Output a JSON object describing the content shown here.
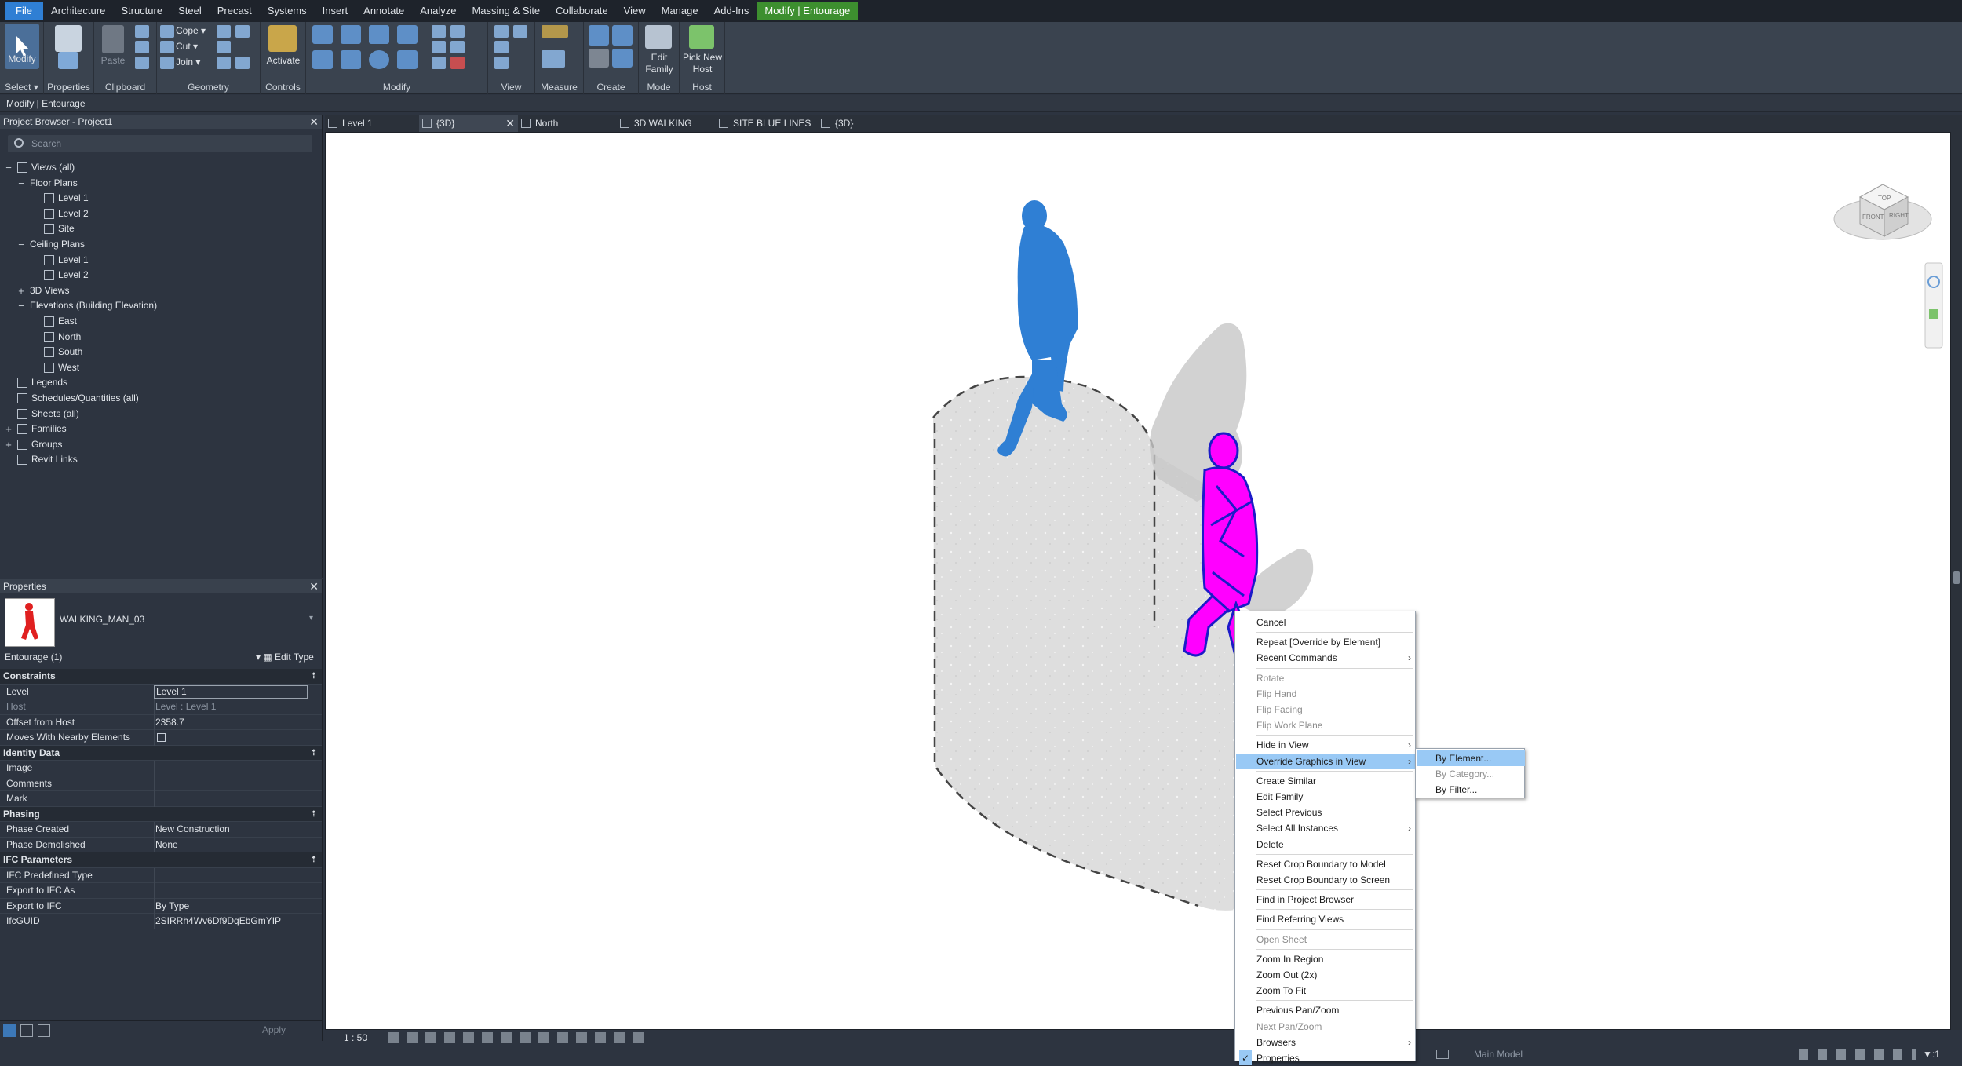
{
  "menubar": {
    "items": [
      "File",
      "Architecture",
      "Structure",
      "Steel",
      "Precast",
      "Systems",
      "Insert",
      "Annotate",
      "Analyze",
      "Massing & Site",
      "Collaborate",
      "View",
      "Manage",
      "Add-Ins",
      "Modify | Entourage"
    ]
  },
  "ribbon": {
    "modify_label": "Modify",
    "properties_label": "Properties",
    "paste_label": "Paste",
    "cope_label": "Cope",
    "cut_label": "Cut",
    "join_label": "Join",
    "activate_label": "Activate",
    "edit_family_label": "Edit Family",
    "pick_new_host_label": "Pick New Host",
    "panels": {
      "select": "Select",
      "properties": "Properties",
      "clipboard": "Clipboard",
      "geometry": "Geometry",
      "controls": "Controls",
      "modify": "Modify",
      "view": "View",
      "measure": "Measure",
      "create": "Create",
      "mode": "Mode",
      "host": "Host"
    }
  },
  "context_bar": "Modify | Entourage",
  "project_browser": {
    "title": "Project Browser - Project1",
    "search_placeholder": "Search",
    "tree": [
      {
        "label": "Views (all)",
        "level": 0,
        "toggle": "−"
      },
      {
        "label": "Floor Plans",
        "level": 1,
        "toggle": "−"
      },
      {
        "label": "Level 1",
        "level": 2,
        "toggle": ""
      },
      {
        "label": "Level 2",
        "level": 2,
        "toggle": ""
      },
      {
        "label": "Site",
        "level": 2,
        "toggle": ""
      },
      {
        "label": "Ceiling Plans",
        "level": 1,
        "toggle": "−"
      },
      {
        "label": "Level 1",
        "level": 2,
        "toggle": ""
      },
      {
        "label": "Level 2",
        "level": 2,
        "toggle": ""
      },
      {
        "label": "3D Views",
        "level": 1,
        "toggle": "+"
      },
      {
        "label": "Elevations (Building Elevation)",
        "level": 1,
        "toggle": "−"
      },
      {
        "label": "East",
        "level": 2,
        "toggle": ""
      },
      {
        "label": "North",
        "level": 2,
        "toggle": ""
      },
      {
        "label": "South",
        "level": 2,
        "toggle": ""
      },
      {
        "label": "West",
        "level": 2,
        "toggle": ""
      },
      {
        "label": "Legends",
        "level": 0,
        "toggle": ""
      },
      {
        "label": "Schedules/Quantities (all)",
        "level": 0,
        "toggle": ""
      },
      {
        "label": "Sheets (all)",
        "level": 0,
        "toggle": ""
      },
      {
        "label": "Families",
        "level": 0,
        "toggle": "+"
      },
      {
        "label": "Groups",
        "level": 0,
        "toggle": "+"
      },
      {
        "label": "Revit Links",
        "level": 0,
        "toggle": ""
      }
    ]
  },
  "properties": {
    "title": "Properties",
    "type_name": "WALKING_MAN_03",
    "instance_filter": "Entourage (1)",
    "edit_type": "Edit Type",
    "apply": "Apply",
    "rows": [
      {
        "k": "Constraints",
        "v": "",
        "kind": "sect"
      },
      {
        "k": "Level",
        "v": "Level 1",
        "kind": "edit"
      },
      {
        "k": "Host",
        "v": "Level : Level 1",
        "kind": "grey"
      },
      {
        "k": "Offset from Host",
        "v": "2358.7",
        "kind": ""
      },
      {
        "k": "Moves With Nearby Elements",
        "v": "",
        "kind": "check"
      },
      {
        "k": "Identity Data",
        "v": "",
        "kind": "sect"
      },
      {
        "k": "Image",
        "v": "",
        "kind": ""
      },
      {
        "k": "Comments",
        "v": "",
        "kind": ""
      },
      {
        "k": "Mark",
        "v": "",
        "kind": ""
      },
      {
        "k": "Phasing",
        "v": "",
        "kind": "sect"
      },
      {
        "k": "Phase Created",
        "v": "New Construction",
        "kind": ""
      },
      {
        "k": "Phase Demolished",
        "v": "None",
        "kind": ""
      },
      {
        "k": "IFC Parameters",
        "v": "",
        "kind": "sect"
      },
      {
        "k": "IFC Predefined Type",
        "v": "",
        "kind": ""
      },
      {
        "k": "Export to IFC As",
        "v": "",
        "kind": ""
      },
      {
        "k": "Export to IFC",
        "v": "By Type",
        "kind": ""
      },
      {
        "k": "IfcGUID",
        "v": "2SIRRh4Wv6Df9DqEbGmYIP",
        "kind": ""
      }
    ]
  },
  "tabs": [
    {
      "label": "Level 1",
      "active": false
    },
    {
      "label": "{3D}",
      "active": true
    },
    {
      "label": "North",
      "active": false
    },
    {
      "label": "3D WALKING",
      "active": false
    },
    {
      "label": "SITE BLUE LINES",
      "active": false
    },
    {
      "label": "{3D}",
      "active": false
    }
  ],
  "viewbar": {
    "scale": "1 : 50"
  },
  "statusbar": {
    "model": "Main Model",
    "filter_count": ":1"
  },
  "viewcube": {
    "top": "TOP",
    "front": "FRONT",
    "right": "RIGHT"
  },
  "context_menu": {
    "items": [
      {
        "label": "Cancel",
        "state": "",
        "sub": false
      },
      {
        "sep": true
      },
      {
        "label": "Repeat [Override by Element]",
        "state": "",
        "sub": false
      },
      {
        "label": "Recent Commands",
        "state": "",
        "sub": true
      },
      {
        "sep": true
      },
      {
        "label": "Rotate",
        "state": "dis",
        "sub": false
      },
      {
        "label": "Flip Hand",
        "state": "dis",
        "sub": false
      },
      {
        "label": "Flip Facing",
        "state": "dis",
        "sub": false
      },
      {
        "label": "Flip Work Plane",
        "state": "dis",
        "sub": false
      },
      {
        "sep": true
      },
      {
        "label": "Hide in View",
        "state": "",
        "sub": true
      },
      {
        "label": "Override Graphics in View",
        "state": "hl",
        "sub": true
      },
      {
        "sep": true
      },
      {
        "label": "Create Similar",
        "state": "",
        "sub": false
      },
      {
        "label": "Edit Family",
        "state": "",
        "sub": false
      },
      {
        "label": "Select Previous",
        "state": "",
        "sub": false
      },
      {
        "label": "Select All Instances",
        "state": "",
        "sub": true
      },
      {
        "label": "Delete",
        "state": "",
        "sub": false
      },
      {
        "sep": true
      },
      {
        "label": "Reset Crop Boundary to Model",
        "state": "",
        "sub": false
      },
      {
        "label": "Reset Crop Boundary to Screen",
        "state": "",
        "sub": false
      },
      {
        "sep": true
      },
      {
        "label": "Find in Project Browser",
        "state": "",
        "sub": false
      },
      {
        "sep": true
      },
      {
        "label": "Find Referring Views",
        "state": "",
        "sub": false
      },
      {
        "sep": true
      },
      {
        "label": "Open Sheet",
        "state": "dis",
        "sub": false
      },
      {
        "sep": true
      },
      {
        "label": "Zoom In Region",
        "state": "",
        "sub": false
      },
      {
        "label": "Zoom Out (2x)",
        "state": "",
        "sub": false
      },
      {
        "label": "Zoom To Fit",
        "state": "",
        "sub": false
      },
      {
        "sep": true
      },
      {
        "label": "Previous Pan/Zoom",
        "state": "",
        "sub": false
      },
      {
        "label": "Next Pan/Zoom",
        "state": "dis",
        "sub": false
      },
      {
        "label": "Browsers",
        "state": "",
        "sub": true
      },
      {
        "label": "Properties",
        "state": "check",
        "sub": false
      }
    ]
  },
  "submenu": {
    "items": [
      {
        "label": "By Element...",
        "state": "hl"
      },
      {
        "label": "By Category...",
        "state": "dis"
      },
      {
        "label": "By Filter...",
        "state": ""
      }
    ]
  },
  "colors": {
    "selected_figure": "#ff00ff",
    "blue_figure": "#2f7fd4",
    "menu_highlight": "#99c9f5",
    "context_tab": "#3d8f2f",
    "file_tab": "#2f7fd4"
  }
}
